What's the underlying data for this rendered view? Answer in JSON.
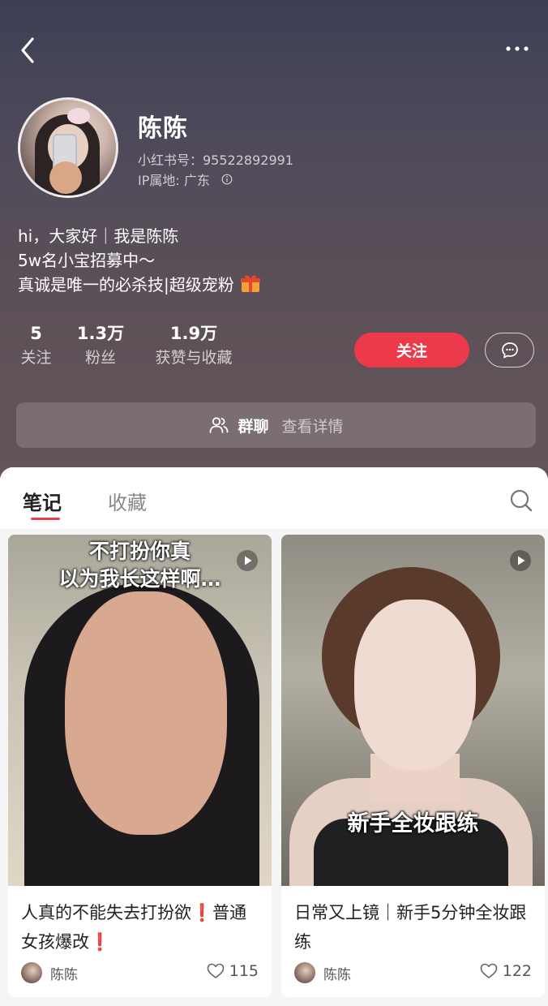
{
  "profile": {
    "name": "陈陈",
    "id_line": "小红书号：95522892991",
    "ip_line": "IP属地: 广东",
    "bio": [
      "hi，大家好｜我是陈陈",
      "5w名小宝招募中～",
      "真诚是唯一的必杀技|超级宠粉"
    ]
  },
  "stats": [
    {
      "value": "5",
      "label": "关注"
    },
    {
      "value": "1.3万",
      "label": "粉丝"
    },
    {
      "value": "1.9万",
      "label": "获赞与收藏"
    }
  ],
  "actions": {
    "follow_label": "关注"
  },
  "group": {
    "title": "群聊",
    "subtitle": "查看详情"
  },
  "tabs": [
    {
      "label": "笔记",
      "active": true
    },
    {
      "label": "收藏",
      "active": false
    }
  ],
  "notes": [
    {
      "cover_text": [
        "不打扮你真",
        "以为我长这样啊…"
      ],
      "title": "人真的不能失去打扮欲❗普通女孩爆改❗",
      "author": "陈陈",
      "likes": "115"
    },
    {
      "cover_text": [
        "新手全妆跟练"
      ],
      "title": "日常又上镜｜新手5分钟全妆跟练",
      "author": "陈陈",
      "likes": "122"
    }
  ],
  "icons": {
    "back": "chevron-left-icon",
    "more": "more-dots-icon",
    "info": "info-icon",
    "gift": "gift-icon",
    "message": "chat-bubble-icon",
    "group": "users-icon",
    "search": "search-icon",
    "play": "play-icon",
    "like": "heart-icon"
  },
  "colors": {
    "accent": "#ec3a4b",
    "header_bg": "#4f4a5a"
  }
}
